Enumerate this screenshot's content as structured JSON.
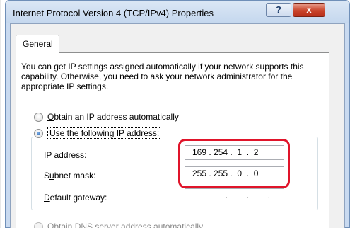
{
  "window": {
    "title": "Internet Protocol Version 4 (TCP/IPv4) Properties",
    "help_label": "?",
    "close_label": "x"
  },
  "tabs": [
    {
      "label": "General",
      "selected": true
    }
  ],
  "description": "You can get IP settings assigned automatically if your network supports this capability. Otherwise, you need to ask your network administrator for the appropriate IP settings.",
  "ip_mode": {
    "auto": {
      "mnemonic": "O",
      "rest": "btain an IP address automatically",
      "checked": false
    },
    "manual": {
      "mnemonic": "U",
      "rest": "se the following IP address:",
      "checked": true
    }
  },
  "fields": {
    "ip_address": {
      "mnemonic": "I",
      "rest": "P address:",
      "value": "169 . 254 .  1  .  2"
    },
    "subnet_mask": {
      "pre": "S",
      "mnemonic": "u",
      "rest": "bnet mask:",
      "value": "255 . 255 .  0  .  0"
    },
    "default_gateway": {
      "mnemonic": "D",
      "rest": "efault gateway:",
      "value": "              .        .        ."
    }
  },
  "dns_mode": {
    "auto": {
      "label": "Obtain DNS server address automatically",
      "checked": false,
      "enabled": false
    }
  },
  "colors": {
    "highlight": "#e0142a",
    "radio_selected": "#1f5aa6",
    "close_button": "#c9452c"
  }
}
